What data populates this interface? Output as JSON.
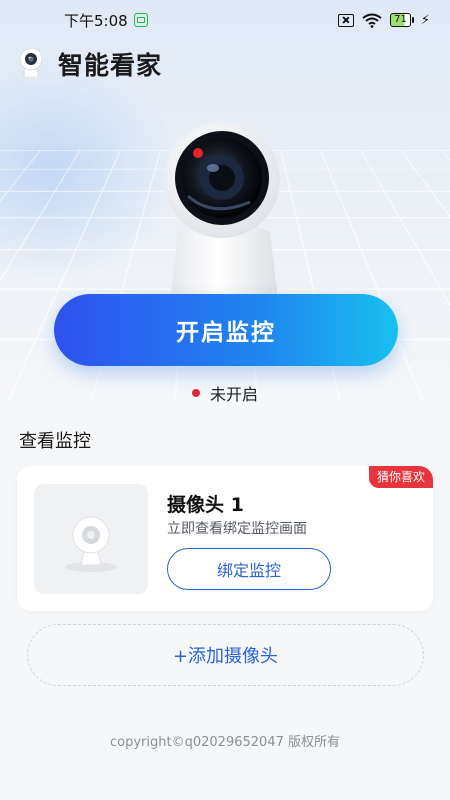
{
  "status_bar": {
    "time": "下午5:08",
    "battery": "71"
  },
  "header": {
    "title": "智能看家"
  },
  "monitor": {
    "start_label": "开启监控",
    "status_text": "未开启",
    "status_color": "#e2263a"
  },
  "section": {
    "title": "查看监控"
  },
  "device_card": {
    "tag": "猜你喜欢",
    "name": "摄像头 1",
    "description": "立即查看绑定监控画面",
    "bind_label": "绑定监控"
  },
  "add_camera": {
    "label": "+添加摄像头"
  },
  "footer": {
    "copyright": "copyright©q02029652047 版权所有"
  },
  "colors": {
    "primary_blue": "#2a63d8",
    "gradient_start": "#2e52ef",
    "gradient_end": "#19c0ef",
    "tag_red": "#e8343c"
  }
}
